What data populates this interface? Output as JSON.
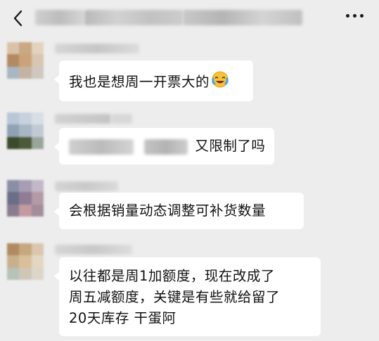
{
  "header": {
    "back_icon": "chevron-left-icon",
    "more_icon": "more-dots-icon"
  },
  "messages": [
    {
      "text_lines": [
        "我也是想周一开票大的"
      ],
      "emoji": "crying-laughing-emoji"
    },
    {
      "text_lines": [
        "又限制了吗"
      ]
    },
    {
      "text_lines": [
        "会根据销量动态调整可补货数量"
      ]
    },
    {
      "text_lines": [
        "以往都是周1加额度，现在改成了",
        "周五减额度，关键是有些就给留了",
        "20天库存 干蛋阿"
      ]
    }
  ],
  "colors": {
    "background": "#ededed",
    "bubble": "#ffffff",
    "text": "#111111"
  }
}
